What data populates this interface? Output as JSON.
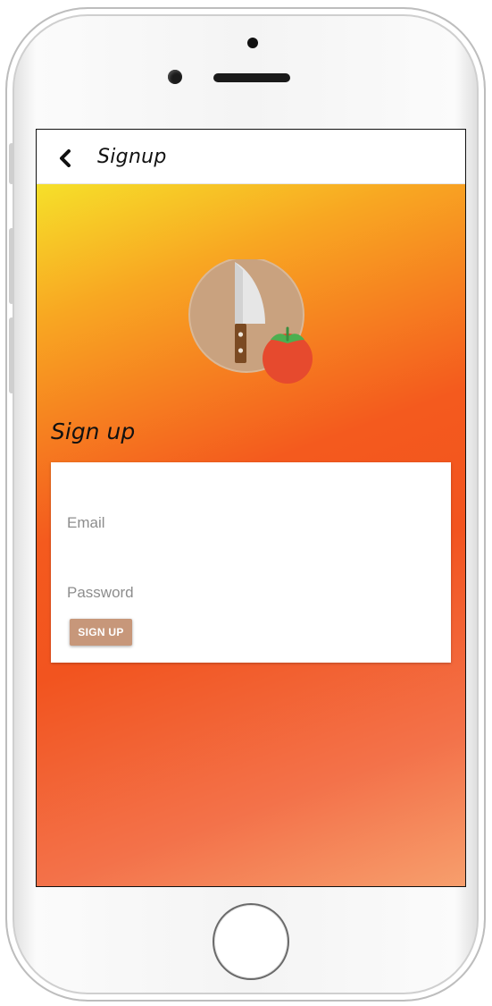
{
  "appbar": {
    "title": "Signup"
  },
  "page": {
    "heading": "Sign up"
  },
  "form": {
    "email_placeholder": "Email",
    "password_placeholder": "Password",
    "submit_label": "SIGN UP"
  },
  "icons": {
    "back": "chevron-left-icon",
    "logo": "knife-tomato-logo"
  },
  "colors": {
    "gradient_top": "#f6e02a",
    "gradient_mid": "#f45a1e",
    "gradient_bottom": "#f79f6d",
    "button_bg": "#c7977a",
    "logo_circle": "#c9a27f",
    "tomato": "#e64a2e"
  }
}
